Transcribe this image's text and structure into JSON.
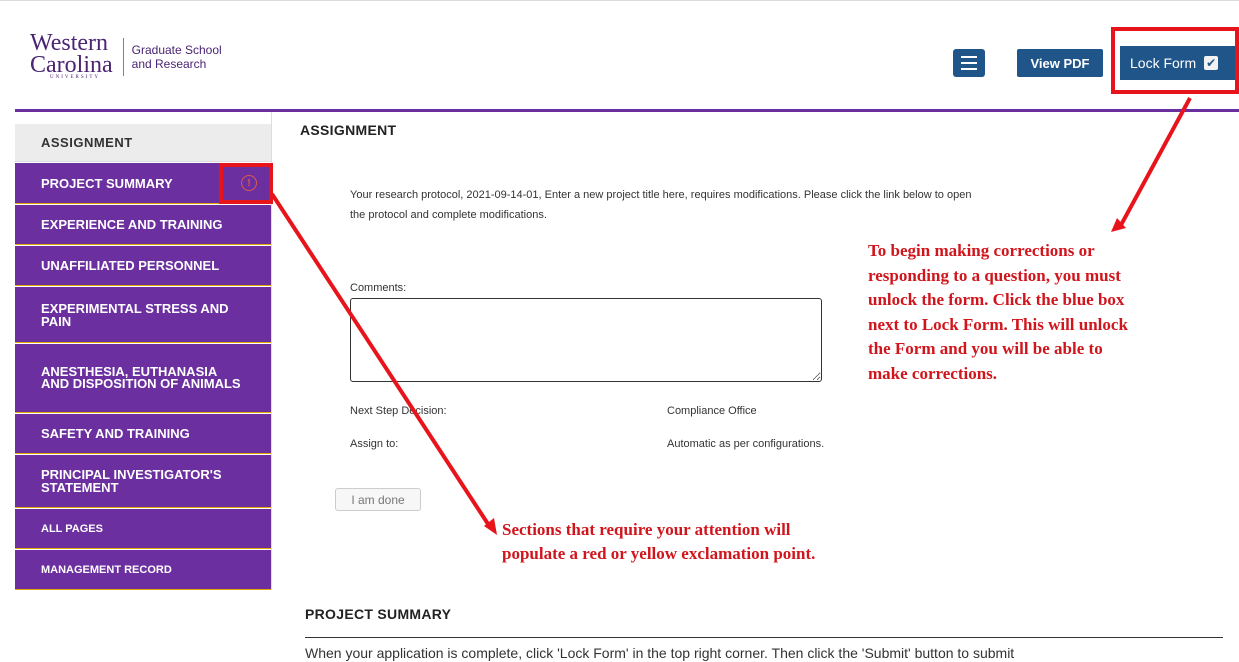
{
  "logo": {
    "wordmark_line1": "Western",
    "wordmark_line2": "Carolina",
    "university": "UNIVERSITY",
    "unit_line1": "Graduate School",
    "unit_line2": "and Research"
  },
  "header": {
    "menu_icon": "hamburger-menu-icon",
    "view_pdf_label": "View PDF",
    "lock_form_label": "Lock Form",
    "lock_checkbox_glyph": "✔"
  },
  "sidebar": {
    "items": [
      {
        "label": "ASSIGNMENT",
        "active": true
      },
      {
        "label": "PROJECT SUMMARY",
        "warning_glyph": "!"
      },
      {
        "label": "EXPERIENCE AND TRAINING"
      },
      {
        "label": "UNAFFILIATED PERSONNEL"
      },
      {
        "label": "EXPERIMENTAL STRESS AND PAIN"
      },
      {
        "label": "ANESTHESIA, EUTHANASIA AND DISPOSITION OF ANIMALS"
      },
      {
        "label": "SAFETY AND TRAINING"
      },
      {
        "label": "PRINCIPAL INVESTIGATOR'S STATEMENT"
      },
      {
        "label": "ALL PAGES"
      },
      {
        "label": "MANAGEMENT RECORD"
      }
    ]
  },
  "main": {
    "assignment_title": "ASSIGNMENT",
    "message_line1": "Your research protocol, 2021-09-14-01, Enter a new project title here, requires modifications. Please click the link below to open",
    "message_line2": "the protocol and complete modifications.",
    "comments_label": "Comments:",
    "comments_value": "",
    "next_step_label": "Next Step Decision:",
    "next_step_value": "Compliance Office",
    "assign_to_label": "Assign to:",
    "assign_to_value": "Automatic as per configurations.",
    "done_button": "I am done",
    "summary_title": "PROJECT SUMMARY",
    "summary_text": "When your application is complete, click 'Lock Form' in the top right corner. Then click the 'Submit' button to submit"
  },
  "annotations": {
    "lock_note": [
      "To begin making corrections or",
      "responding to a question, you must",
      "unlock the form. Click the blue box",
      "next to Lock Form. This will unlock",
      "the Form and you will be able to",
      "make corrections."
    ],
    "section_note": [
      "Sections that require your attention will",
      "populate a red or yellow exclamation point."
    ],
    "color": "#e8141c"
  }
}
